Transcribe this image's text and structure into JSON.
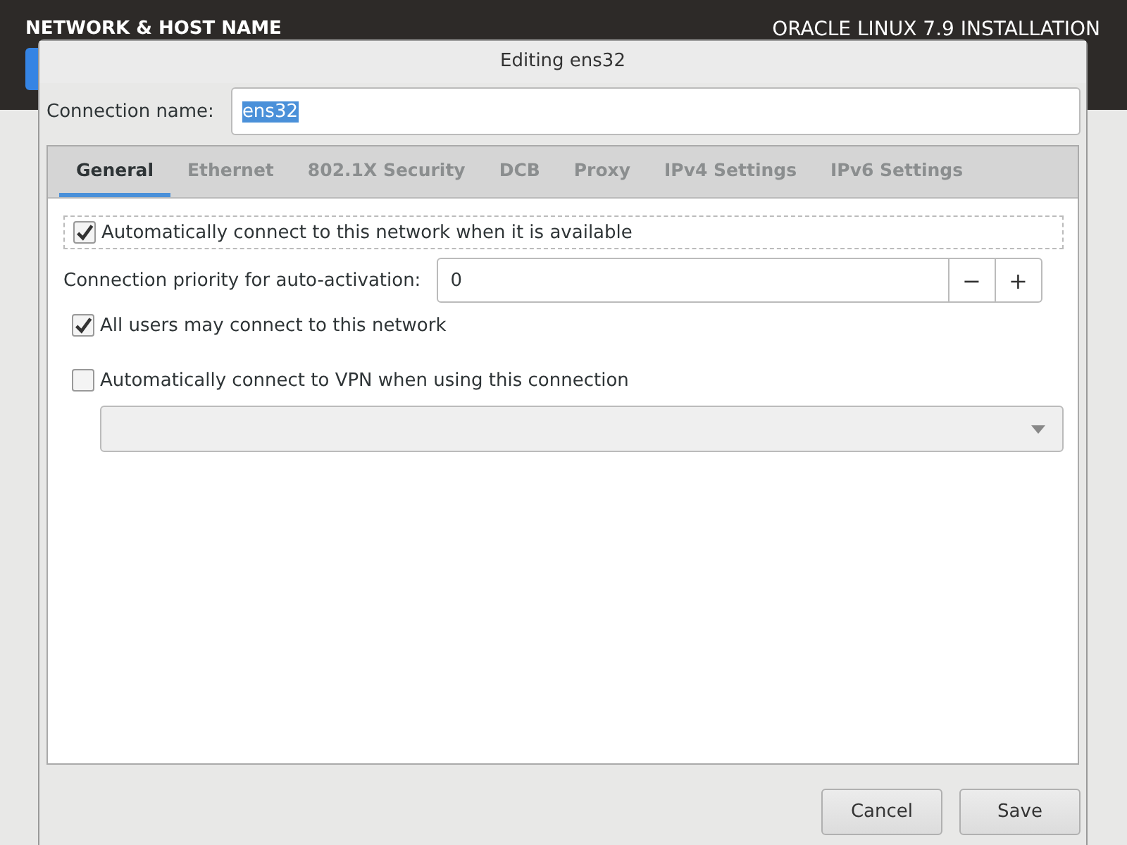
{
  "header": {
    "title": "NETWORK & HOST NAME",
    "product": "ORACLE LINUX 7.9 INSTALLATION"
  },
  "dialog": {
    "title": "Editing ens32",
    "connection_name": {
      "label": "Connection name:",
      "value": "ens32",
      "selected": true
    },
    "tabs": [
      {
        "label": "General",
        "selected": true
      },
      {
        "label": "Ethernet",
        "selected": false
      },
      {
        "label": "802.1X Security",
        "selected": false
      },
      {
        "label": "DCB",
        "selected": false
      },
      {
        "label": "Proxy",
        "selected": false
      },
      {
        "label": "IPv4 Settings",
        "selected": false
      },
      {
        "label": "IPv6 Settings",
        "selected": false
      }
    ],
    "auto_connect": {
      "label": "Automatically connect to this network when it is available",
      "checked": true
    },
    "priority": {
      "label": "Connection priority for auto-activation:",
      "value": "0",
      "decrement": "−",
      "increment": "+"
    },
    "all_users": {
      "label": "All users may connect to this network",
      "checked": true
    },
    "vpn": {
      "label": "Automatically connect to VPN when using this connection",
      "checked": false
    },
    "buttons": [
      "Cancel",
      "Save"
    ]
  }
}
